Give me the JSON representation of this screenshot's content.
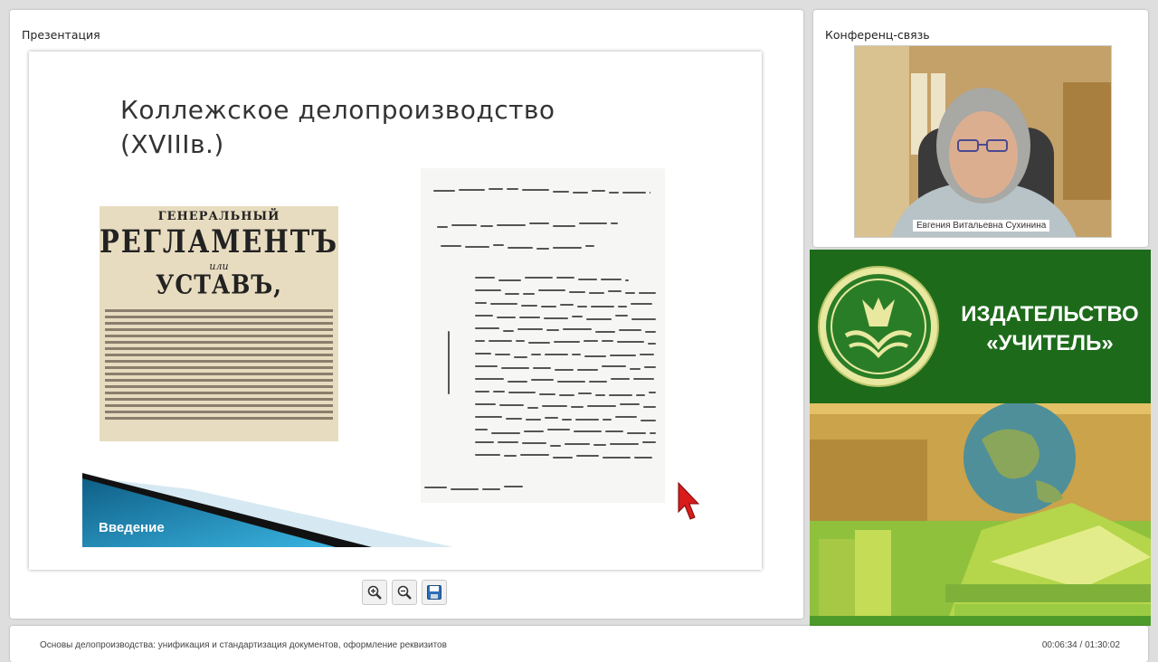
{
  "presentation": {
    "panel_title": "Презентация",
    "slide": {
      "title": "Коллежское делопроизводство\n(XVIIIв.)",
      "doc1": {
        "line1": "ГЕНЕРАЛЬНЫЙ",
        "line2": "РЕГЛАМЕНТЪ",
        "line3": "или",
        "line4": "УСТАВЪ,"
      },
      "intro_label": "Введение"
    },
    "tools": [
      "zoom-in-icon",
      "zoom-out-icon",
      "save-icon"
    ]
  },
  "conference": {
    "panel_title": "Конференц-связь",
    "speaker_name": "Евгения Витальевна Сухинина"
  },
  "publisher": {
    "name": "ИЗДАТЕЛЬСТВО\n«УЧИТЕЛЬ»"
  },
  "bottom": {
    "course_title": "Основы делопроизводства: унификация и стандартизация документов, оформление реквизитов",
    "time": "00:06:34 / 01:30:02"
  },
  "colors": {
    "publisher_green": "#1d6b1a",
    "banner_blue": "#1b7fa8",
    "cursor_red": "#d81b1b"
  }
}
